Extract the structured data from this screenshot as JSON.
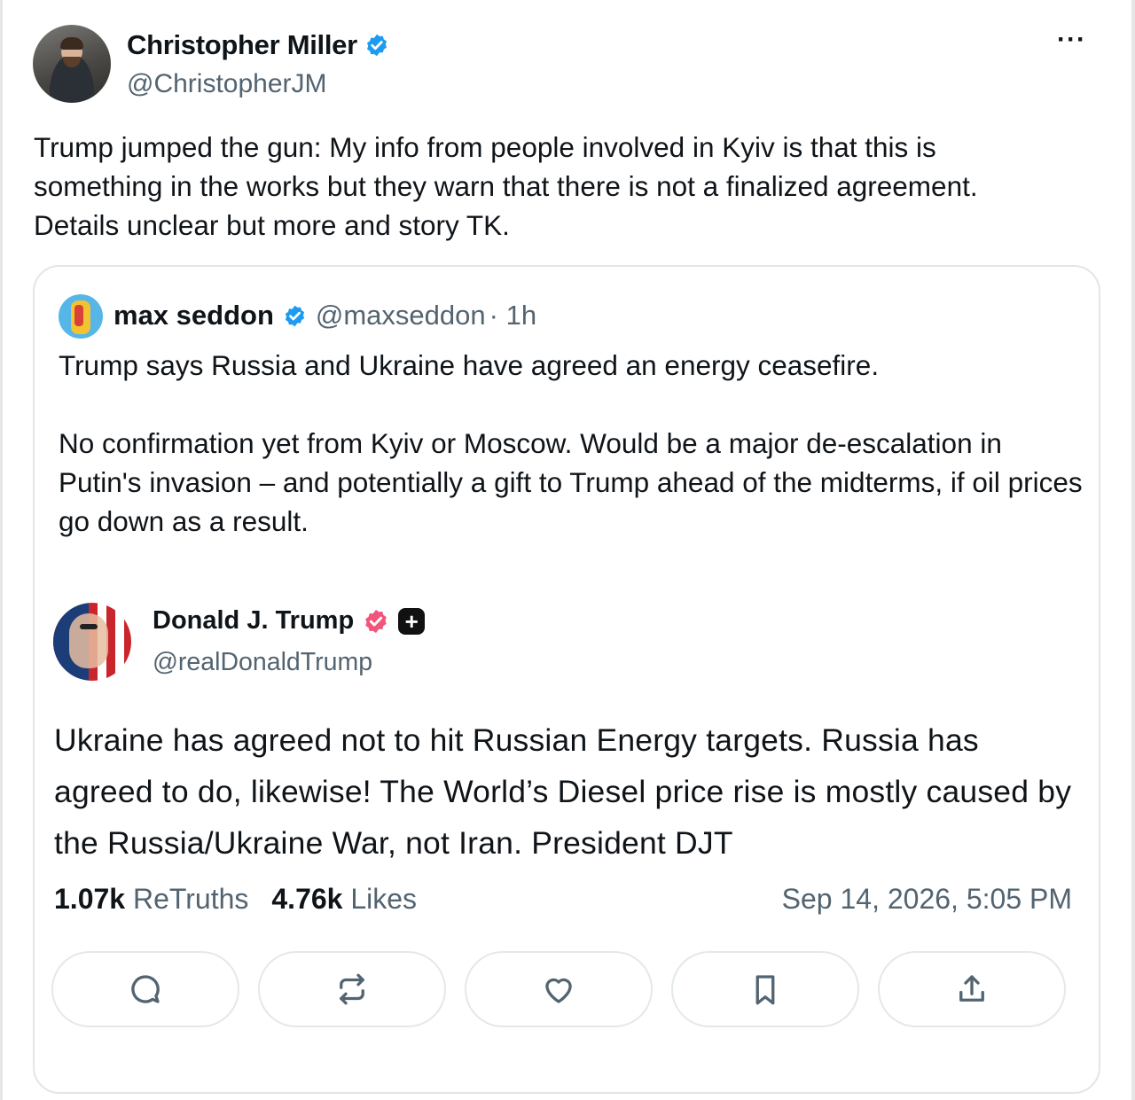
{
  "post": {
    "author_name": "Christopher Miller",
    "author_handle": "@ChristopherJM",
    "more_label": "···",
    "text_lines": [
      "Trump jumped the gun: My info from people involved in Kyiv is that this is",
      "something in the works but they warn that there is not a finalized agreement.",
      "Details unclear but more and story TK."
    ]
  },
  "quote": {
    "author_name": "max seddon",
    "author_handle": "@maxseddon",
    "time": "· 1h",
    "paragraphs": [
      "Trump says Russia and Ukraine have agreed an energy ceasefire.",
      "No confirmation yet from Kyiv or Moscow. Would be a major de-escalation in Putin's invasion – and potentially a gift to Trump ahead of the midterms, if oil prices go down as a result."
    ]
  },
  "embedded": {
    "author_name": "Donald J. Trump",
    "author_handle": "@realDonaldTrump",
    "text": "Ukraine has agreed not to hit Russian Energy targets. Russia has agreed to do, likewise! The World’s Diesel price rise is mostly caused by the Russia/Ukraine War, not Iran. President DJT",
    "retruths_count": "1.07k",
    "retruths_label": "ReTruths",
    "likes_count": "4.76k",
    "likes_label": "Likes",
    "timestamp": "Sep 14, 2026, 5:05 PM",
    "actions": [
      "reply-icon",
      "retruth-icon",
      "like-icon",
      "bookmark-icon",
      "share-icon"
    ]
  },
  "colors": {
    "verified_blue": "#1d9bf0",
    "verified_pink": "#f2557a",
    "muted_text": "#536471",
    "border": "#e0e6ea"
  }
}
